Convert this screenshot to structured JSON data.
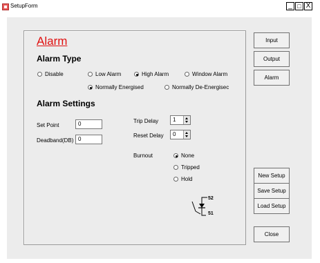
{
  "window": {
    "title": "SetupForm",
    "minimize": "_",
    "maximize": "□",
    "close": "X"
  },
  "alarm": {
    "heading": "Alarm",
    "type_heading": "Alarm Type",
    "radios": [
      {
        "label": "Disable",
        "selected": false
      },
      {
        "label": "Low Alarm",
        "selected": false
      },
      {
        "label": "High Alarm",
        "selected": true
      },
      {
        "label": "Window Alarm",
        "selected": false
      }
    ],
    "energise": [
      {
        "label": "Normally Energised",
        "selected": true
      },
      {
        "label": "Normally De-Energisec",
        "selected": false
      }
    ],
    "settings_heading": "Alarm Settings",
    "set_point": {
      "label": "Set Point",
      "value": "0"
    },
    "deadband": {
      "label": "Deadband(DB)",
      "value": "0"
    },
    "trip_delay": {
      "label": "Trip Delay",
      "value": "1"
    },
    "reset_delay": {
      "label": "Reset Delay",
      "value": "0"
    },
    "burnout": {
      "label": "Burnout",
      "options": [
        {
          "label": "None",
          "selected": true
        },
        {
          "label": "Tripped",
          "selected": false
        },
        {
          "label": "Hold",
          "selected": false
        }
      ]
    },
    "diagram": {
      "pin_top": "52",
      "pin_bottom": "51"
    }
  },
  "buttons": {
    "input": "Input",
    "output": "Output",
    "alarm": "Alarm",
    "new_setup": "New Setup",
    "save_setup": "Save Setup",
    "load_setup": "Load Setup",
    "close": "Close"
  },
  "colors": {
    "heading_red": "#e01010",
    "panel_bg": "#ececec"
  }
}
